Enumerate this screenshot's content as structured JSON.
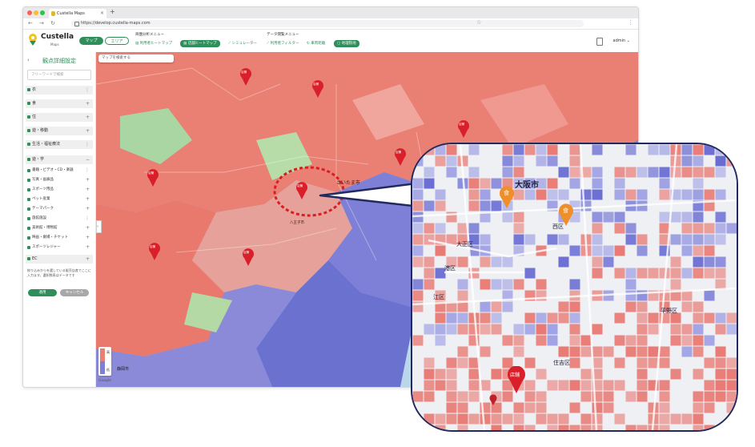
{
  "browser": {
    "tab_title": "Custella Maps",
    "tab_close": "×",
    "new_tab": "+",
    "url": "https://develop.custella-maps.com"
  },
  "app": {
    "brand_name": "Custella",
    "brand_sub": "Maps",
    "mode_tabs": [
      {
        "label": "マップ"
      },
      {
        "label": "エリア"
      }
    ],
    "analysis_menu": {
      "label": "商圏分析メニュー",
      "items": [
        {
          "label": "利用者ヒートマップ"
        },
        {
          "label": "店舗ヒートマップ"
        },
        {
          "label": "シミュレーター"
        }
      ]
    },
    "data_menu": {
      "label": "データ閲覧メニュー",
      "items": [
        {
          "label": "利用者フィルター"
        },
        {
          "label": "車両距離"
        },
        {
          "label": "地理院地"
        }
      ]
    },
    "user": "admin"
  },
  "sidebar": {
    "title": "観点詳細設定",
    "keyword_placeholder": "フリーワードで検索",
    "categories": [
      {
        "label": "衣"
      },
      {
        "label": "食"
      },
      {
        "label": "住"
      },
      {
        "label": "遊・移動"
      },
      {
        "label": "生活・福祉療法"
      },
      {
        "label": "遊・学"
      }
    ],
    "subcategories": [
      {
        "label": "書籍・ビデオ・CD・楽器"
      },
      {
        "label": "写真・画廊品"
      },
      {
        "label": "スポーツ用品"
      },
      {
        "label": "ペット産業"
      },
      {
        "label": "テーマパーク"
      },
      {
        "label": "旅館施設"
      },
      {
        "label": "美術館・博物館"
      },
      {
        "label": "映画・劇場・チケット"
      },
      {
        "label": "スポーツレジャー"
      }
    ],
    "ec": {
      "label": "EC"
    },
    "note": "絞り込みからを選している販売店産でここに入力ます。選択肢表はデータです",
    "apply_label": "適用",
    "cancel_label": "キャンセル"
  },
  "map": {
    "search_placeholder": "マップを検索する",
    "store_label": "店舗",
    "food_label": "食",
    "labels": [
      {
        "text": "さいたま市"
      },
      {
        "text": "八王子市"
      },
      {
        "text": "静岡市"
      },
      {
        "text": "Google"
      }
    ],
    "legend_high": "高",
    "legend_low": "低"
  },
  "callout": {
    "labels": [
      {
        "text": "大阪市"
      },
      {
        "text": "大正区"
      },
      {
        "text": "港区"
      },
      {
        "text": "西区"
      },
      {
        "text": "江区"
      },
      {
        "text": "平野区"
      },
      {
        "text": "住吉区"
      }
    ],
    "store_label": "店舗",
    "food_label": "食"
  },
  "colors": {
    "accent": "#2f8f5b",
    "heat_red": "#e8736c",
    "heat_blue": "#6b6fd3",
    "callout_border": "#22295c",
    "highlight_ring": "#d81f1f"
  }
}
